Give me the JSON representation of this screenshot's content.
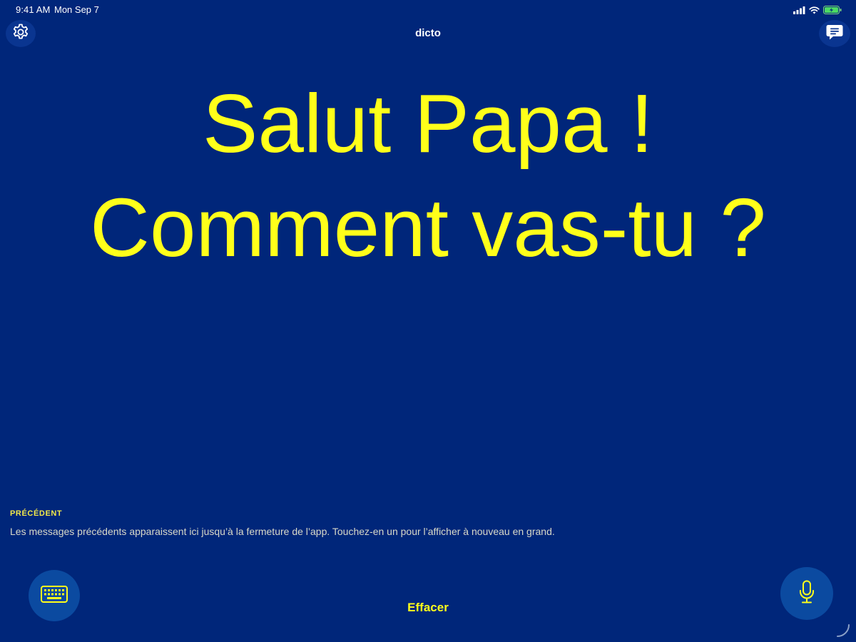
{
  "status_bar": {
    "time": "9:41 AM",
    "date": "Mon Sep 7",
    "icons": [
      "cellular-signal-icon",
      "wifi-icon",
      "battery-charging-icon"
    ]
  },
  "nav": {
    "title": "dicto",
    "left_icon": "gear-icon",
    "right_icon": "message-bubble-icon"
  },
  "main": {
    "spoken_text": "Salut Papa ! Comment vas-tu ?"
  },
  "previous": {
    "heading": "PRÉCÉDENT",
    "hint": "Les messages précédents apparaissent ici jusqu’à la fermeture de l’app. Touchez-en un pour l’afficher à nouveau en grand."
  },
  "bottom_bar": {
    "keyboard_icon": "keyboard-icon",
    "clear_label": "Effacer",
    "mic_icon": "microphone-icon"
  },
  "colors": {
    "background": "#00267a",
    "accent_yellow": "#ffff1a",
    "button_blue": "#0b4aa0"
  }
}
